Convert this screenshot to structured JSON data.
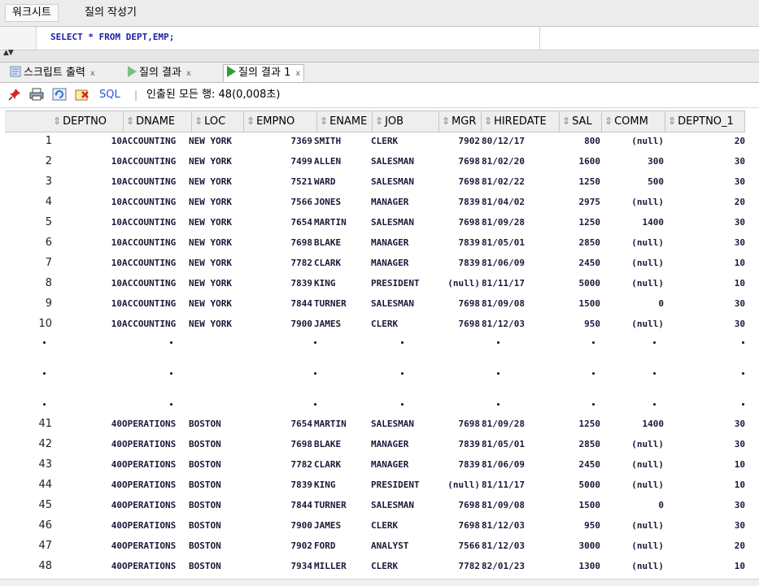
{
  "top_tabs": {
    "worksheet": "워크시트",
    "query_builder": "질의 작성기"
  },
  "editor": {
    "sql": "SELECT * FROM DEPT,EMP;"
  },
  "result_tabs": [
    {
      "label": "스크립트 출력",
      "close": "x"
    },
    {
      "label": "질의 결과",
      "close": "x"
    },
    {
      "label": "질의 결과 1",
      "close": "x"
    }
  ],
  "toolbar": {
    "sql_label": "SQL",
    "separator": "|",
    "status": "인출된 모든 행: 48(0,008초)"
  },
  "columns": [
    "DEPTNO",
    "DNAME",
    "LOC",
    "EMPNO",
    "ENAME",
    "JOB",
    "MGR",
    "HIREDATE",
    "SAL",
    "COMM",
    "DEPTNO_1"
  ],
  "rows_top": [
    [
      "1",
      "10",
      "ACCOUNTING",
      "NEW YORK",
      "7369",
      "SMITH",
      "CLERK",
      "7902",
      "80/12/17",
      "800",
      "(null)",
      "20"
    ],
    [
      "2",
      "10",
      "ACCOUNTING",
      "NEW YORK",
      "7499",
      "ALLEN",
      "SALESMAN",
      "7698",
      "81/02/20",
      "1600",
      "300",
      "30"
    ],
    [
      "3",
      "10",
      "ACCOUNTING",
      "NEW YORK",
      "7521",
      "WARD",
      "SALESMAN",
      "7698",
      "81/02/22",
      "1250",
      "500",
      "30"
    ],
    [
      "4",
      "10",
      "ACCOUNTING",
      "NEW YORK",
      "7566",
      "JONES",
      "MANAGER",
      "7839",
      "81/04/02",
      "2975",
      "(null)",
      "20"
    ],
    [
      "5",
      "10",
      "ACCOUNTING",
      "NEW YORK",
      "7654",
      "MARTIN",
      "SALESMAN",
      "7698",
      "81/09/28",
      "1250",
      "1400",
      "30"
    ],
    [
      "6",
      "10",
      "ACCOUNTING",
      "NEW YORK",
      "7698",
      "BLAKE",
      "MANAGER",
      "7839",
      "81/05/01",
      "2850",
      "(null)",
      "30"
    ],
    [
      "7",
      "10",
      "ACCOUNTING",
      "NEW YORK",
      "7782",
      "CLARK",
      "MANAGER",
      "7839",
      "81/06/09",
      "2450",
      "(null)",
      "10"
    ],
    [
      "8",
      "10",
      "ACCOUNTING",
      "NEW YORK",
      "7839",
      "KING",
      "PRESIDENT",
      "(null)",
      "81/11/17",
      "5000",
      "(null)",
      "10"
    ],
    [
      "9",
      "10",
      "ACCOUNTING",
      "NEW YORK",
      "7844",
      "TURNER",
      "SALESMAN",
      "7698",
      "81/09/08",
      "1500",
      "0",
      "30"
    ],
    [
      "10",
      "10",
      "ACCOUNTING",
      "NEW YORK",
      "7900",
      "JAMES",
      "CLERK",
      "7698",
      "81/12/03",
      "950",
      "(null)",
      "30"
    ]
  ],
  "rows_bottom": [
    [
      "41",
      "40",
      "OPERATIONS",
      "BOSTON",
      "7654",
      "MARTIN",
      "SALESMAN",
      "7698",
      "81/09/28",
      "1250",
      "1400",
      "30"
    ],
    [
      "42",
      "40",
      "OPERATIONS",
      "BOSTON",
      "7698",
      "BLAKE",
      "MANAGER",
      "7839",
      "81/05/01",
      "2850",
      "(null)",
      "30"
    ],
    [
      "43",
      "40",
      "OPERATIONS",
      "BOSTON",
      "7782",
      "CLARK",
      "MANAGER",
      "7839",
      "81/06/09",
      "2450",
      "(null)",
      "10"
    ],
    [
      "44",
      "40",
      "OPERATIONS",
      "BOSTON",
      "7839",
      "KING",
      "PRESIDENT",
      "(null)",
      "81/11/17",
      "5000",
      "(null)",
      "10"
    ],
    [
      "45",
      "40",
      "OPERATIONS",
      "BOSTON",
      "7844",
      "TURNER",
      "SALESMAN",
      "7698",
      "81/09/08",
      "1500",
      "0",
      "30"
    ],
    [
      "46",
      "40",
      "OPERATIONS",
      "BOSTON",
      "7900",
      "JAMES",
      "CLERK",
      "7698",
      "81/12/03",
      "950",
      "(null)",
      "30"
    ],
    [
      "47",
      "40",
      "OPERATIONS",
      "BOSTON",
      "7902",
      "FORD",
      "ANALYST",
      "7566",
      "81/12/03",
      "3000",
      "(null)",
      "20"
    ],
    [
      "48",
      "40",
      "OPERATIONS",
      "BOSTON",
      "7934",
      "MILLER",
      "CLERK",
      "7782",
      "82/01/23",
      "1300",
      "(null)",
      "10"
    ]
  ],
  "colors": {
    "keyword": "#1e1ea8",
    "run_icon": "#2ea02e",
    "link": "#2a56c6"
  }
}
